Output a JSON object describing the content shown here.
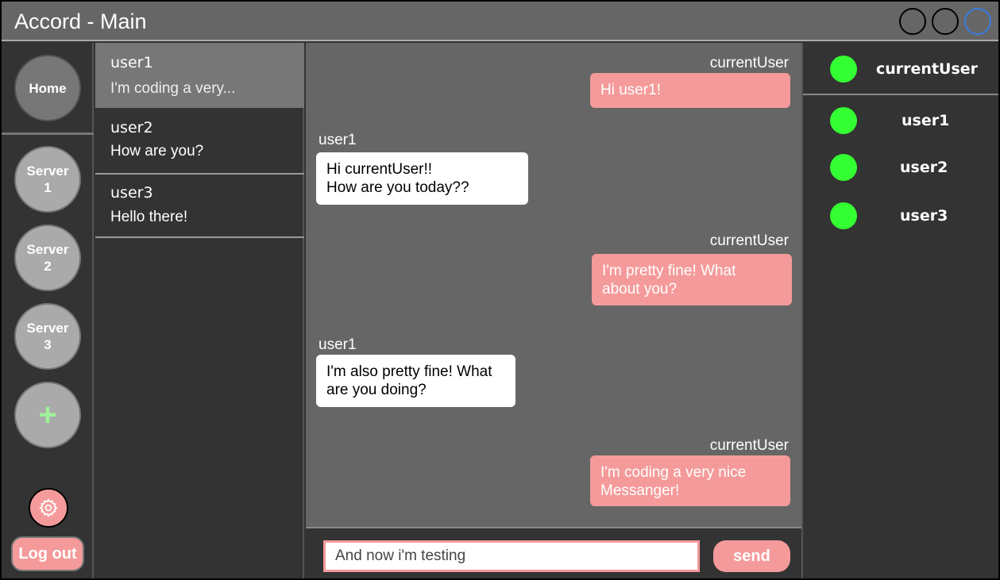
{
  "window": {
    "title": "Accord - Main",
    "controls": [
      "window-button-1",
      "window-button-2",
      "window-button-3"
    ]
  },
  "rail": {
    "home_label": "Home",
    "servers": [
      {
        "label": "Server\n1"
      },
      {
        "label": "Server\n2"
      },
      {
        "label": "Server\n3"
      }
    ],
    "add_label": "+",
    "settings_icon": "gear-icon",
    "logout_label": "Log out"
  },
  "conversations": [
    {
      "name": "user1",
      "preview": "I'm coding a very..."
    },
    {
      "name": "user2",
      "preview": "How are you?"
    },
    {
      "name": "user3",
      "preview": "Hello there!"
    }
  ],
  "messages": [
    {
      "sender": "currentUser",
      "lines": [
        "Hi user1!"
      ],
      "mine": true
    },
    {
      "sender": "user1",
      "lines": [
        "Hi currentUser!!",
        "How are you today??"
      ],
      "mine": false
    },
    {
      "sender": "currentUser",
      "lines": [
        "I'm pretty fine! What",
        "about you?"
      ],
      "mine": true
    },
    {
      "sender": "user1",
      "lines": [
        "I'm also pretty fine! What",
        "are you doing?"
      ],
      "mine": false
    },
    {
      "sender": "currentUser",
      "lines": [
        "I'm coding a very nice",
        "Messanger!"
      ],
      "mine": true
    }
  ],
  "composer": {
    "value": "And now i'm testing",
    "send_label": "send"
  },
  "members": [
    {
      "name": "currentUser"
    },
    {
      "name": "user1"
    },
    {
      "name": "user2"
    },
    {
      "name": "user3"
    }
  ],
  "colors": {
    "accent": "#f59a9a",
    "online": "#33ff33",
    "panel": "#333333",
    "chat_bg": "#666666"
  }
}
